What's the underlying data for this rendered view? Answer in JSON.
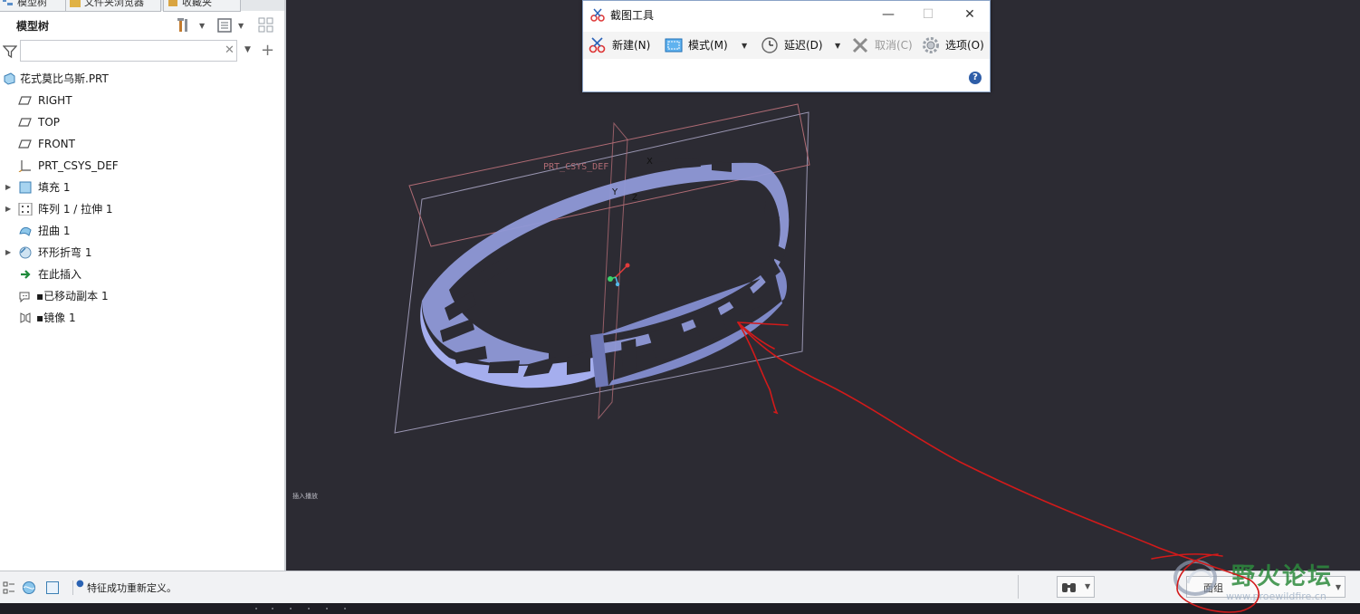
{
  "left_panel": {
    "tabs": [
      {
        "label": "模型树"
      },
      {
        "label": "文件夹浏览器"
      },
      {
        "label": "收藏夹"
      }
    ],
    "tree_title": "模型树",
    "filter_placeholder": "",
    "tree_items": [
      {
        "label": "花式莫比乌斯.PRT",
        "icon": "part-icon",
        "expandable": false
      },
      {
        "label": "RIGHT",
        "icon": "datum-plane-icon",
        "expandable": false
      },
      {
        "label": "TOP",
        "icon": "datum-plane-icon",
        "expandable": false
      },
      {
        "label": "FRONT",
        "icon": "datum-plane-icon",
        "expandable": false
      },
      {
        "label": "PRT_CSYS_DEF",
        "icon": "csys-icon",
        "expandable": false
      },
      {
        "label": "填充 1",
        "icon": "fill-icon",
        "expandable": true
      },
      {
        "label": "阵列 1 / 拉伸 1",
        "icon": "pattern-icon",
        "expandable": true
      },
      {
        "label": "扭曲 1",
        "icon": "warp-icon",
        "expandable": false
      },
      {
        "label": "环形折弯 1",
        "icon": "toroidal-bend-icon",
        "expandable": true
      },
      {
        "label": "在此插入",
        "icon": "insert-here-icon",
        "expandable": false
      },
      {
        "label": "已移动副本 1",
        "icon": "moved-copy-icon",
        "expandable": false
      },
      {
        "label": "镜像 1",
        "icon": "mirror-icon",
        "expandable": false
      }
    ]
  },
  "snipping_tool": {
    "title": "截图工具",
    "buttons": {
      "new": "新建(N)",
      "mode": "模式(M)",
      "delay": "延迟(D)",
      "cancel": "取消(C)",
      "options": "选项(O)"
    },
    "help": "?"
  },
  "viewport": {
    "csys_label": "PRT_CSYS_DEF",
    "axis_x": "X",
    "axis_y": "Y",
    "axis_z": "Z",
    "corner_label": "插入播放",
    "model_color": "#99a3e2",
    "annotation_color": "#d21a1a"
  },
  "status_bar": {
    "message": "特征成功重新定义。",
    "filter_value": "面组"
  },
  "watermark": {
    "name": "野火论坛",
    "url": "www.proewildfire.cn"
  }
}
